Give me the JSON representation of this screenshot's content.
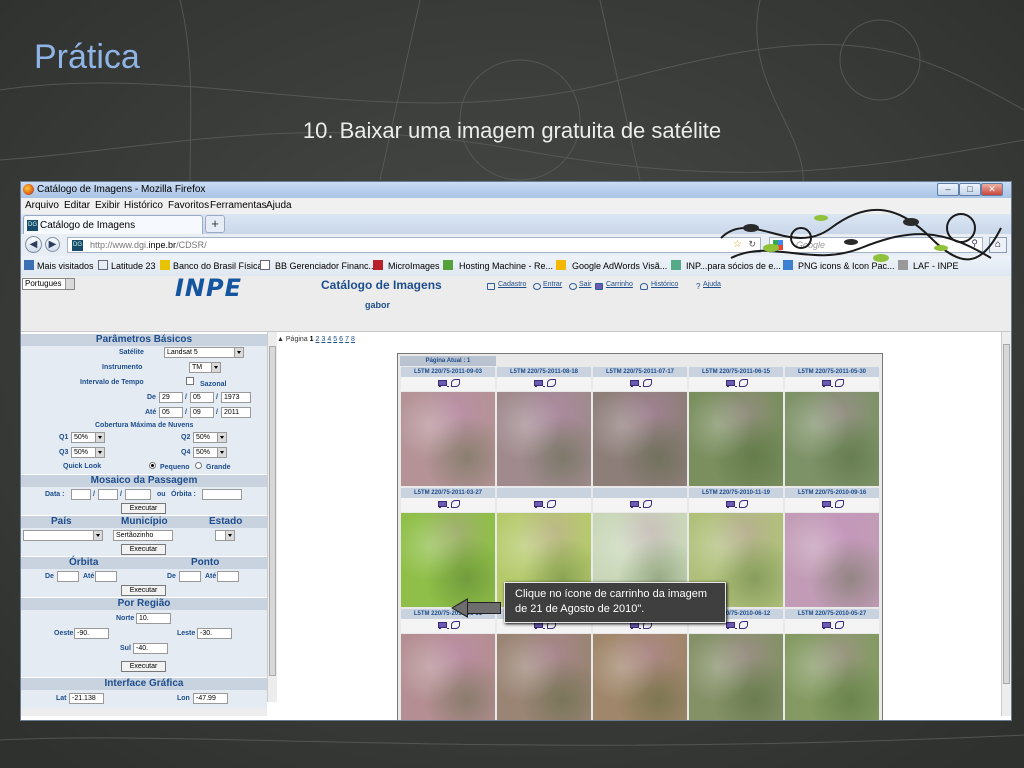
{
  "slide": {
    "title": "Prática",
    "subtitle": "10. Baixar uma imagem gratuita de satélite"
  },
  "browser": {
    "window_title": "Catálogo de Imagens - Mozilla Firefox",
    "menu": [
      "Arquivo",
      "Editar",
      "Exibir",
      "Histórico",
      "Favoritos",
      "Ferramentas",
      "Ajuda"
    ],
    "tab_title": "Catálogo de Imagens",
    "url_prefix": "http://www.dgi.",
    "url_host": "inpe.br",
    "url_path": "/CDSR/",
    "search_placeholder": "Google",
    "bookmarks": [
      "Mais visitados",
      "Latitude 23",
      "Banco do Brasil Física",
      "BB Gerenciador Financ...",
      "MicroImages",
      "Hosting Machine - Re...",
      "Google AdWords Visã...",
      "INP...para sócios de e...",
      "PNG icons & Icon Pac...",
      "LAF - INPE"
    ]
  },
  "site": {
    "language": "Portugues",
    "logo": "INPE",
    "title": "Catálogo de Imagens",
    "user": "gabor",
    "links": [
      "Cadastro",
      "Entrar",
      "Sair",
      "Carrinho",
      "Histórico",
      "Ajuda"
    ]
  },
  "form": {
    "basic": {
      "header": "Parâmetros Básicos",
      "satellite_label": "Satélite",
      "satellite": "Landsat 5",
      "instrument_label": "Instrumento",
      "instrument": "TM",
      "interval_label": "Intervalo de Tempo",
      "seasonal_label": "Sazonal",
      "from_label": "De",
      "from_d": "29",
      "from_m": "05",
      "from_y": "1973",
      "to_label": "Até",
      "to_d": "05",
      "to_m": "09",
      "to_y": "2011",
      "clouds_label": "Cobertura Máxima de Nuvens",
      "q1_label": "Q1",
      "q1": "50%",
      "q2_label": "Q2",
      "q2": "50%",
      "q3_label": "Q3",
      "q3": "50%",
      "q4_label": "Q4",
      "q4": "50%",
      "quicklook_label": "Quick Look",
      "small_label": "Pequeno",
      "large_label": "Grande"
    },
    "mosaic": {
      "header": "Mosaico da Passagem",
      "date_label": "Data :",
      "or_label": "ou",
      "orbit_label": "Órbita :",
      "exec": "Executar"
    },
    "place": {
      "country_label": "País",
      "city_label": "Município",
      "state_label": "Estado",
      "city": "Sertãozinho",
      "exec": "Executar"
    },
    "orbitpoint": {
      "orbit_label": "Órbita",
      "point_label": "Ponto",
      "from_label": "De",
      "to_label": "Até",
      "exec": "Executar"
    },
    "region": {
      "header": "Por Região",
      "north_label": "Norte",
      "north": "10.",
      "west_label": "Oeste",
      "west": "-90.",
      "east_label": "Leste",
      "east": "-30.",
      "south_label": "Sul",
      "south": "-40.",
      "exec": "Executar"
    },
    "graphic": {
      "header": "Interface Gráfica",
      "lat_label": "Lat",
      "lat": "-21.138",
      "lon_label": "Lon",
      "lon": "-47.99"
    }
  },
  "results": {
    "pager_label": "Página",
    "current_page": "1",
    "pages": [
      "2",
      "3",
      "4",
      "5",
      "6",
      "7",
      "8"
    ],
    "current_label": "Página Atual : 1",
    "scenes": [
      {
        "label": "L5TM 220/75-2011-09-03",
        "tone": "#b49296"
      },
      {
        "label": "L5TM 220/75-2011-08-18",
        "tone": "#a08a8e"
      },
      {
        "label": "L5TM 220/75-2011-07-17",
        "tone": "#8e7e7a"
      },
      {
        "label": "L5TM 220/75-2011-06-15",
        "tone": "#7a8e5e"
      },
      {
        "label": "L5TM 220/75-2011-05-30",
        "tone": "#7e9268"
      },
      {
        "label": "L5TM 220/75-2011-03-27",
        "tone": "#8fbf48"
      },
      {
        "label": "",
        "tone": "#b6ca6c"
      },
      {
        "label": "",
        "tone": "#c9d7b8"
      },
      {
        "label": "L5TM 220/75-2010-11-19",
        "tone": "#b0c07a"
      },
      {
        "label": "L5TM 220/75-2010-09-16",
        "tone": "#c29cb6"
      },
      {
        "label": "L5TM 220/75-2010-08-31",
        "tone": "#b48e92"
      },
      {
        "label": "L5TM 220/75-2010-08-15",
        "tone": "#9a8474"
      },
      {
        "label": "L5TM 220/75-2010-07-30",
        "tone": "#a0866a"
      },
      {
        "label": "L5TM 220/75-2010-06-12",
        "tone": "#849066"
      },
      {
        "label": "L5TM 220/75-2010-05-27",
        "tone": "#849a62"
      }
    ]
  },
  "callout": {
    "text": "Clique no ícone de carrinho da imagem de 21 de Agosto de 2010\"."
  }
}
